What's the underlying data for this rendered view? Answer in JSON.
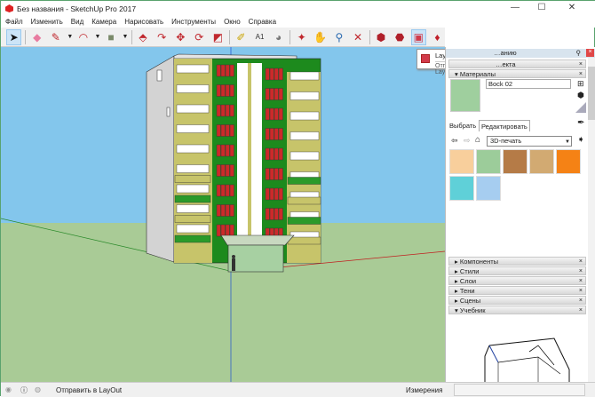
{
  "window": {
    "title": "Без названия - SketchUp Pro 2017",
    "minimize": "—",
    "maximize": "☐",
    "close": "✕"
  },
  "menu": [
    "Файл",
    "Изменить",
    "Вид",
    "Камера",
    "Нарисовать",
    "Инструменты",
    "Окно",
    "Справка"
  ],
  "toolbar": [
    {
      "icon": "select-arrow-icon",
      "glyph": "➤",
      "color": "#111",
      "selected": true
    },
    {
      "icon": "eraser-icon",
      "glyph": "◆",
      "color": "#e87ba0"
    },
    {
      "icon": "pencil-icon",
      "glyph": "✎",
      "color": "#c0282e",
      "dropdown": true
    },
    {
      "icon": "arc-icon",
      "glyph": "◠",
      "color": "#c0282e",
      "dropdown": true
    },
    {
      "icon": "rectangle-icon",
      "glyph": "■",
      "color": "#7a8a6a",
      "dropdown": true
    },
    {
      "icon": "push-pull-icon",
      "glyph": "⬘",
      "color": "#c0282e"
    },
    {
      "icon": "follow-me-icon",
      "glyph": "↷",
      "color": "#c0282e"
    },
    {
      "icon": "move-icon",
      "glyph": "✥",
      "color": "#c0282e"
    },
    {
      "icon": "rotate-icon",
      "glyph": "⟳",
      "color": "#c0282e"
    },
    {
      "icon": "scale-icon",
      "glyph": "◩",
      "color": "#c0282e"
    },
    {
      "icon": "tape-measure-icon",
      "glyph": "✐",
      "color": "#c9a400"
    },
    {
      "icon": "text-icon",
      "glyph": "A1",
      "color": "#333"
    },
    {
      "icon": "paint-bucket-icon",
      "glyph": "◕",
      "color": "#777"
    },
    {
      "icon": "orbit-icon",
      "glyph": "✦",
      "color": "#c0282e"
    },
    {
      "icon": "pan-icon",
      "glyph": "✋",
      "color": "#d9c28a"
    },
    {
      "icon": "zoom-icon",
      "glyph": "⚲",
      "color": "#2a6ab0"
    },
    {
      "icon": "zoom-extents-icon",
      "glyph": "✕",
      "color": "#c0282e"
    },
    {
      "icon": "3d-warehouse-icon",
      "glyph": "⬢",
      "color": "#b0202a"
    },
    {
      "icon": "extension-warehouse-icon",
      "glyph": "⬣",
      "color": "#b0202a"
    },
    {
      "icon": "send-to-layout-icon",
      "glyph": "▣",
      "color": "#d23a4a",
      "selected": true
    },
    {
      "icon": "extension-manager-icon",
      "glyph": "♦",
      "color": "#c0202a"
    }
  ],
  "tooltip": {
    "title": "LayOut",
    "description": "Отправить в LayOut"
  },
  "panel": {
    "tray_title": "…анию",
    "entity_info_title": "…екта",
    "materials": {
      "title": "Материалы",
      "name": "Bock 02",
      "tab_select": "Выбрать",
      "tab_edit": "Редактировать",
      "library": "3D-печать",
      "swatches": [
        "#f8cf9c",
        "#9ccc9a",
        "#b57b47",
        "#d2aa72",
        "#f58215",
        "#5fd0d8",
        "#a6cdf0"
      ],
      "current_color": "#9fcf9e"
    },
    "sections": [
      "Компоненты",
      "Стили",
      "Слои",
      "Тени",
      "Сцены",
      "Учебник"
    ]
  },
  "status": {
    "message": "Отправить в LayOut",
    "measurements_label": "Измерения",
    "measurements_value": ""
  },
  "colors": {
    "sky": "#83c6ec",
    "ground": "#a9cb96",
    "facade_green": "#1d8a1d",
    "balcony_yellow": "#c7c46a",
    "window_red": "#cc2a2a"
  }
}
